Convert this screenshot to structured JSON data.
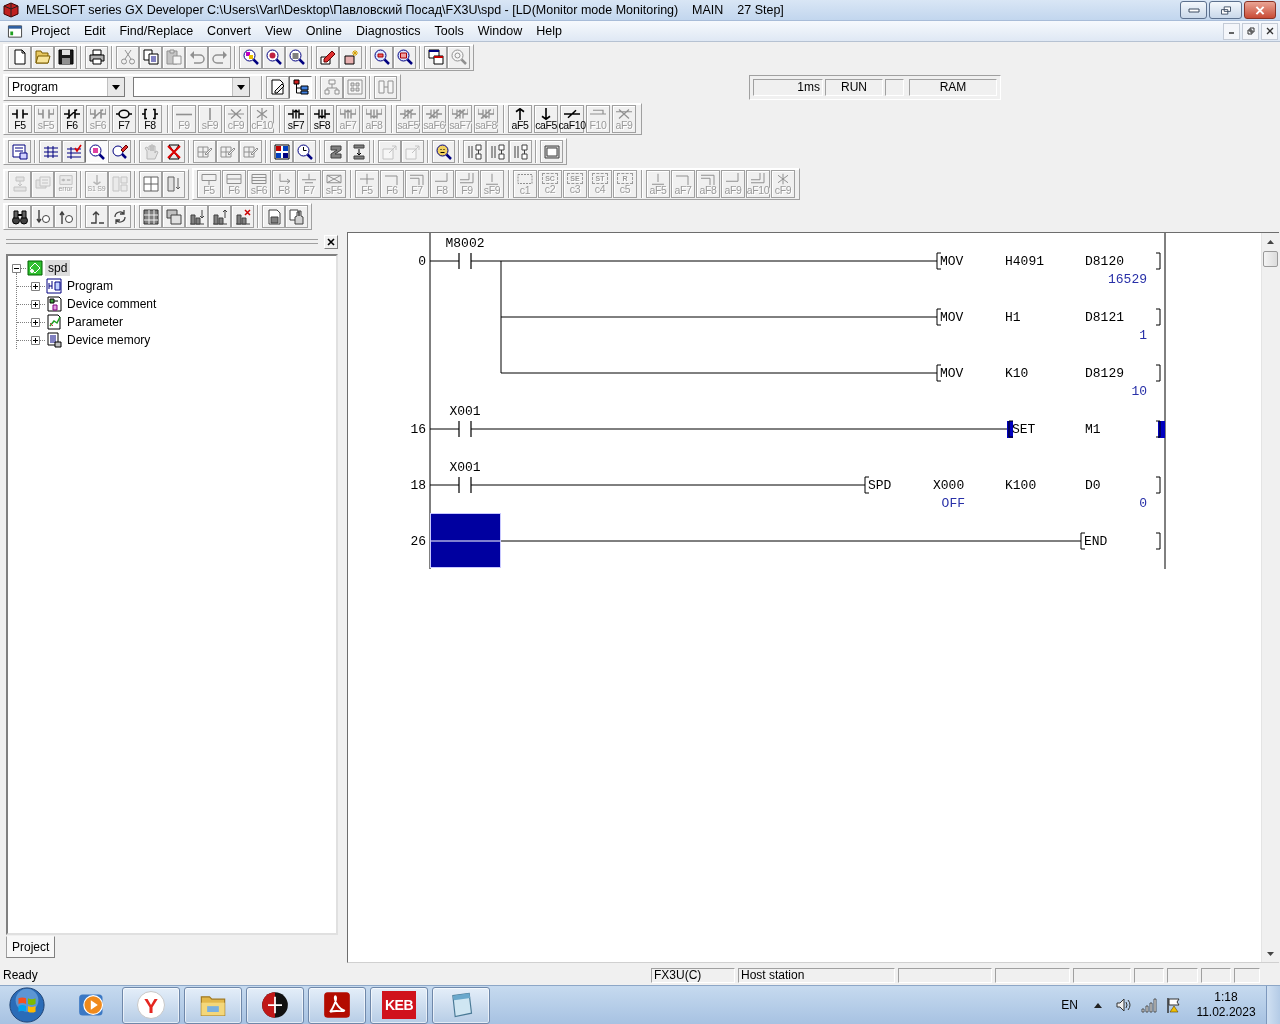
{
  "window": {
    "title": "MELSOFT series GX Developer C:\\Users\\Varl\\Desktop\\Павловский Посад\\FX3U\\spd - [LD(Monitor mode Monitoring)    MAIN    27 Step]"
  },
  "menu": [
    "Project",
    "Edit",
    "Find/Replace",
    "Convert",
    "View",
    "Online",
    "Diagnostics",
    "Tools",
    "Window",
    "Help"
  ],
  "toolbars": [
    {
      "bands": [
        {
          "groups": [
            [
              {
                "kind": "new-file",
                "disabled": false,
                "pressed": false
              },
              {
                "kind": "folder",
                "disabled": false,
                "pressed": false
              },
              {
                "kind": "floppy",
                "disabled": false,
                "pressed": false
              }
            ],
            [
              {
                "kind": "printer",
                "disabled": false,
                "pressed": false
              }
            ],
            [
              {
                "kind": "scissors",
                "disabled": true,
                "pressed": false
              },
              {
                "kind": "copy",
                "disabled": false,
                "pressed": false
              },
              {
                "kind": "paste",
                "disabled": true,
                "pressed": false
              },
              {
                "kind": "undo",
                "disabled": true,
                "pressed": false
              },
              {
                "kind": "redo",
                "disabled": true,
                "pressed": false
              }
            ],
            [
              {
                "kind": "mag-color",
                "disabled": false,
                "pressed": false
              },
              {
                "kind": "mag-red",
                "disabled": false,
                "pressed": false
              },
              {
                "kind": "mag-text",
                "disabled": false,
                "pressed": false
              }
            ],
            [
              {
                "kind": "pencil-box",
                "disabled": false,
                "pressed": false
              },
              {
                "kind": "sparkle-box",
                "disabled": false,
                "pressed": false
              }
            ],
            [
              {
                "kind": "zoom-in",
                "disabled": false,
                "pressed": false
              },
              {
                "kind": "zoom-out",
                "disabled": false,
                "pressed": false
              }
            ],
            [
              {
                "kind": "window",
                "disabled": false,
                "pressed": false
              },
              {
                "kind": "mag-gear",
                "disabled": true,
                "pressed": false
              }
            ]
          ]
        }
      ]
    },
    {
      "bands": [
        {
          "groups": [
            [
              {
                "kind": "dropdown",
                "value": "Program"
              },
              {
                "kind": "dropdown"
              }
            ],
            [
              {
                "kind": "doc-pencil",
                "disabled": false,
                "pressed": false
              },
              {
                "kind": "tree",
                "disabled": false,
                "pressed": true
              }
            ],
            [
              {
                "kind": "hierarchy",
                "disabled": true,
                "pressed": false
              },
              {
                "kind": "grid-doc",
                "disabled": true,
                "pressed": false
              }
            ],
            [
              {
                "kind": "columns",
                "disabled": true,
                "pressed": false
              }
            ]
          ]
        }
      ],
      "status": {
        "scan_time": "1ms",
        "mode": "RUN",
        "memory": "RAM"
      }
    },
    {
      "bands": [
        {
          "groups": [
            [
              {
                "kind": "contact",
                "key": "F5",
                "disabled": false,
                "pressed": false
              },
              {
                "kind": "par-contact",
                "key": "sF5",
                "disabled": true,
                "pressed": false
              },
              {
                "kind": "nc-contact",
                "key": "F6",
                "disabled": false,
                "pressed": false
              },
              {
                "kind": "par-nc",
                "key": "sF6",
                "disabled": true,
                "pressed": false
              },
              {
                "kind": "coil",
                "key": "F7",
                "disabled": false,
                "pressed": false
              },
              {
                "kind": "braces",
                "key": "F8",
                "disabled": false,
                "pressed": false
              }
            ],
            [
              {
                "kind": "hline",
                "key": "F9",
                "disabled": true,
                "pressed": false
              },
              {
                "kind": "vline",
                "key": "sF9",
                "disabled": true,
                "pressed": false
              },
              {
                "kind": "hline-x",
                "key": "cF9",
                "disabled": true,
                "pressed": false
              },
              {
                "kind": "vline-x",
                "key": "cF10",
                "disabled": true,
                "pressed": false
              }
            ],
            [
              {
                "kind": "rise",
                "key": "sF7",
                "disabled": false,
                "pressed": false
              },
              {
                "kind": "fall",
                "key": "sF8",
                "disabled": false,
                "pressed": false
              },
              {
                "kind": "par-rise",
                "key": "aF7",
                "disabled": true,
                "pressed": false
              },
              {
                "kind": "par-fall",
                "key": "aF8",
                "disabled": true,
                "pressed": false
              }
            ],
            [
              {
                "kind": "rise-nc",
                "key": "saF5",
                "disabled": true,
                "pressed": false
              },
              {
                "kind": "fall-nc",
                "key": "saF6",
                "disabled": true,
                "pressed": false
              },
              {
                "kind": "par-rise-nc",
                "key": "saF7",
                "disabled": true,
                "pressed": false
              },
              {
                "kind": "par-fall-nc",
                "key": "saF8",
                "disabled": true,
                "pressed": false
              }
            ],
            [
              {
                "kind": "arrow-up",
                "key": "aF5",
                "disabled": false,
                "pressed": false
              },
              {
                "kind": "arrow-down",
                "key": "caF5",
                "disabled": false,
                "pressed": false
              },
              {
                "kind": "invert",
                "key": "caF10",
                "disabled": false,
                "pressed": false
              },
              {
                "kind": "rule",
                "key": "F10",
                "disabled": true,
                "pressed": false
              },
              {
                "kind": "rule-x",
                "key": "aF9",
                "disabled": true,
                "pressed": false
              }
            ]
          ]
        }
      ]
    },
    {
      "bands": [
        {
          "groups": [
            [
              {
                "kind": "ladder-list",
                "disabled": false,
                "pressed": false
              }
            ],
            [
              {
                "kind": "lines",
                "disabled": false,
                "pressed": false
              },
              {
                "kind": "lines-check",
                "disabled": false,
                "pressed": false
              },
              {
                "kind": "mag-pink",
                "disabled": false,
                "pressed": true
              },
              {
                "kind": "mag-pencil",
                "disabled": false,
                "pressed": false
              }
            ],
            [
              {
                "kind": "hand",
                "disabled": true,
                "pressed": false
              },
              {
                "kind": "hourglass-x",
                "disabled": false,
                "pressed": false
              }
            ],
            [
              {
                "kind": "grid-pencil",
                "disabled": true,
                "pressed": false
              },
              {
                "kind": "grid-pencil",
                "disabled": true,
                "pressed": false
              },
              {
                "kind": "grid-pencil",
                "disabled": true,
                "pressed": false
              }
            ],
            [
              {
                "kind": "grid-color",
                "disabled": false,
                "pressed": false
              },
              {
                "kind": "clock-mag",
                "disabled": false,
                "pressed": false
              }
            ],
            [
              {
                "kind": "block",
                "disabled": false,
                "pressed": false
              },
              {
                "kind": "block-arrow",
                "disabled": false,
                "pressed": false
              }
            ],
            [
              {
                "kind": "box-arrow",
                "disabled": true,
                "pressed": false
              },
              {
                "kind": "box-arrow",
                "disabled": true,
                "pressed": false
              }
            ],
            [
              {
                "kind": "face-mag",
                "disabled": false,
                "pressed": false
              }
            ],
            [
              {
                "kind": "arrows-cols",
                "disabled": false,
                "pressed": false
              },
              {
                "kind": "arrows-cols",
                "disabled": false,
                "pressed": false
              },
              {
                "kind": "arrows-cols",
                "disabled": false,
                "pressed": false
              }
            ],
            [
              {
                "kind": "screen",
                "disabled": false,
                "pressed": false
              }
            ]
          ]
        }
      ]
    },
    {
      "bands": [
        {
          "groups": [
            [
              {
                "kind": "step-down",
                "disabled": true,
                "pressed": false
              },
              {
                "kind": "board",
                "disabled": true,
                "pressed": false
              },
              {
                "kind": "error-box",
                "caption": "error",
                "disabled": true,
                "pressed": false
              }
            ],
            [
              {
                "kind": "s-down",
                "caption": "S1 S9",
                "disabled": true,
                "pressed": false
              },
              {
                "kind": "split",
                "disabled": true,
                "pressed": false
              }
            ],
            [
              {
                "kind": "grid4",
                "disabled": false,
                "pressed": false
              },
              {
                "kind": "split-arrow",
                "disabled": false,
                "pressed": false
              }
            ]
          ]
        },
        {
          "groups": [
            [
              {
                "kind": "box-top",
                "key": "F5",
                "disabled": true,
                "pressed": false
              },
              {
                "kind": "box-double",
                "key": "F6",
                "disabled": true,
                "pressed": false
              },
              {
                "kind": "box-triple",
                "key": "sF6",
                "disabled": true,
                "pressed": false
              },
              {
                "kind": "elbow-arrow",
                "key": "F8",
                "disabled": true,
                "pressed": false
              },
              {
                "kind": "ground",
                "key": "F7",
                "disabled": true,
                "pressed": false
              },
              {
                "kind": "envelope",
                "key": "sF5",
                "disabled": true,
                "pressed": false
              }
            ],
            [
              {
                "kind": "plus",
                "key": "F5",
                "disabled": true,
                "pressed": false
              },
              {
                "kind": "corner",
                "key": "F6",
                "disabled": true,
                "pressed": false
              },
              {
                "kind": "corner-double",
                "key": "F7",
                "disabled": true,
                "pressed": false
              },
              {
                "kind": "corner-rev",
                "key": "F8",
                "disabled": true,
                "pressed": false
              },
              {
                "kind": "corner-rev-double",
                "key": "F9",
                "disabled": true,
                "pressed": false
              },
              {
                "kind": "tick-line",
                "key": "sF9",
                "disabled": true,
                "pressed": false
              }
            ],
            [
              {
                "kind": "dashed-box",
                "key": "c1",
                "disabled": true,
                "pressed": false
              },
              {
                "kind": "caption-box",
                "caption": "SC",
                "key": "c2",
                "disabled": true,
                "pressed": false
              },
              {
                "kind": "caption-box",
                "caption": "SE",
                "key": "c3",
                "disabled": true,
                "pressed": false
              },
              {
                "kind": "caption-box",
                "caption": "ST",
                "key": "c4",
                "disabled": true,
                "pressed": false
              },
              {
                "kind": "caption-box",
                "caption": "R",
                "key": "c5",
                "disabled": true,
                "pressed": false
              }
            ],
            [
              {
                "kind": "tick-line",
                "key": "aF5",
                "disabled": true,
                "pressed": false
              },
              {
                "kind": "corner",
                "key": "aF7",
                "disabled": true,
                "pressed": false
              },
              {
                "kind": "corner-double",
                "key": "aF8",
                "disabled": true,
                "pressed": false
              },
              {
                "kind": "corner-rev",
                "key": "aF9",
                "disabled": true,
                "pressed": false
              },
              {
                "kind": "corner-rev-double",
                "key": "aF10",
                "disabled": true,
                "pressed": false
              },
              {
                "kind": "asterisk",
                "key": "cF9",
                "disabled": true,
                "pressed": false
              }
            ]
          ]
        }
      ]
    },
    {
      "bands": [
        {
          "groups": [
            [
              {
                "kind": "binoculars",
                "disabled": false,
                "pressed": false
              },
              {
                "kind": "down-mag",
                "disabled": false,
                "pressed": false
              },
              {
                "kind": "up-mag",
                "disabled": false,
                "pressed": false
              }
            ],
            [
              {
                "kind": "return",
                "disabled": false,
                "pressed": false
              },
              {
                "kind": "cycle",
                "disabled": false,
                "pressed": false
              }
            ],
            [
              {
                "kind": "grid-dark",
                "disabled": false,
                "pressed": false
              },
              {
                "kind": "win-stack",
                "disabled": false,
                "pressed": false
              },
              {
                "kind": "bars-down",
                "disabled": false,
                "pressed": false
              },
              {
                "kind": "bars-up",
                "disabled": false,
                "pressed": false
              },
              {
                "kind": "bars-x",
                "disabled": false,
                "pressed": false
              }
            ],
            [
              {
                "kind": "doc-save",
                "disabled": false,
                "pressed": false
              },
              {
                "kind": "hand-doc",
                "disabled": false,
                "pressed": false
              }
            ]
          ]
        }
      ]
    }
  ],
  "project_panel": {
    "tree": {
      "label": "spd",
      "kind": "project",
      "expanded": true,
      "selected": true,
      "children": [
        {
          "label": "Program",
          "kind": "program",
          "expanded": false,
          "selected": false
        },
        {
          "label": "Device comment",
          "kind": "device-comment",
          "expanded": false,
          "selected": false
        },
        {
          "label": "Parameter",
          "kind": "parameter",
          "expanded": false,
          "selected": false
        },
        {
          "label": "Device memory",
          "kind": "device-memory",
          "expanded": false,
          "selected": false
        }
      ]
    },
    "tabs": [
      {
        "label": "Project",
        "selected": true
      }
    ]
  },
  "ladder": {
    "rungs": [
      {
        "step": "0",
        "selected": false,
        "contacts": [
          {
            "device": "M8002",
            "on": false
          }
        ],
        "outputs": [
          {
            "mnemonic": "MOV",
            "on": false,
            "operands": [
              {
                "device": "H4091"
              },
              {
                "device": "D8120",
                "value": "16529"
              }
            ]
          },
          {
            "mnemonic": "MOV",
            "on": false,
            "operands": [
              {
                "device": "H1"
              },
              {
                "device": "D8121",
                "value": "1"
              }
            ]
          },
          {
            "mnemonic": "MOV",
            "on": false,
            "operands": [
              {
                "device": "K10"
              },
              {
                "device": "D8129",
                "value": "10"
              }
            ]
          }
        ]
      },
      {
        "step": "16",
        "selected": false,
        "contacts": [
          {
            "device": "X001",
            "on": false
          }
        ],
        "outputs": [
          {
            "mnemonic": "SET",
            "on": true,
            "operands": [
              {
                "device": "M1"
              }
            ]
          }
        ]
      },
      {
        "step": "18",
        "selected": false,
        "contacts": [
          {
            "device": "X001",
            "on": false
          }
        ],
        "outputs": [
          {
            "mnemonic": "SPD",
            "on": false,
            "operands": [
              {
                "device": "X000",
                "value": "OFF"
              },
              {
                "device": "K100"
              },
              {
                "device": "D0",
                "value": "0"
              }
            ]
          }
        ]
      },
      {
        "step": "26",
        "selected": true,
        "outputs": [
          {
            "mnemonic": "END",
            "on": false
          }
        ]
      }
    ]
  },
  "status_bar": {
    "message": "Ready",
    "plc_type": "FX3U(C)",
    "station": "Host station"
  },
  "taskbar": {
    "items": [
      {
        "kind": "media-player",
        "running": false
      },
      {
        "kind": "letter-browser",
        "label": "Y",
        "running": true
      },
      {
        "kind": "file-explorer",
        "running": true
      },
      {
        "kind": "plc-app",
        "running": true
      },
      {
        "kind": "pdf-reader",
        "running": true
      },
      {
        "kind": "letter-logo",
        "label": "KEB",
        "running": true
      },
      {
        "kind": "notepad",
        "running": true
      }
    ],
    "tray": {
      "language": "EN",
      "time": "1:18",
      "date": "11.02.2023"
    }
  }
}
